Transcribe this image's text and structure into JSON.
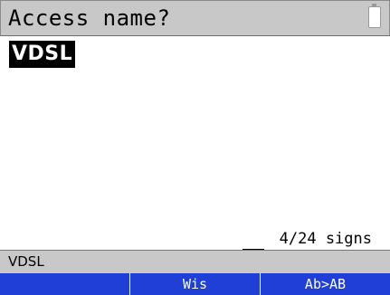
{
  "header": {
    "title": "Access name?",
    "battery_icon": "battery-empty-icon"
  },
  "input": {
    "value": "VDSL"
  },
  "counter": {
    "text": "4/24 signs",
    "used": 4,
    "max": 24
  },
  "status": {
    "text": "VDSL"
  },
  "softkeys": [
    "",
    "Wis",
    "Ab>AB"
  ],
  "colors": {
    "softkey_bg": "#1f3fd6",
    "title_bg": "#c8c8c8",
    "selection_bg": "#000000"
  }
}
